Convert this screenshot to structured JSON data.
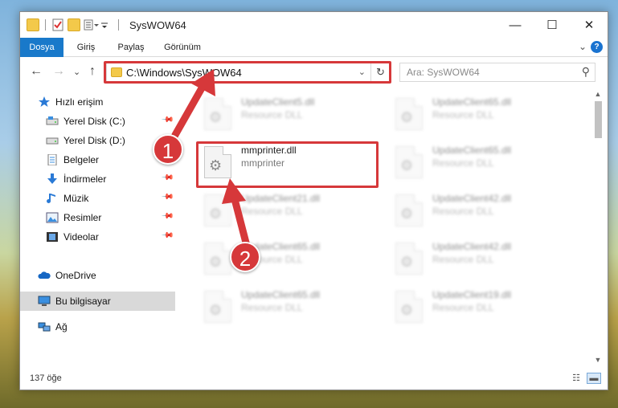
{
  "window": {
    "title": "SysWOW64",
    "controls": {
      "minimize": "—",
      "maximize": "☐",
      "close": "✕"
    }
  },
  "ribbon": {
    "tabs": [
      {
        "label": "Dosya",
        "active": true
      },
      {
        "label": "Giriş",
        "active": false
      },
      {
        "label": "Paylaş",
        "active": false
      },
      {
        "label": "Görünüm",
        "active": false
      }
    ],
    "expand": "⌄",
    "help": "?"
  },
  "nav": {
    "back": "←",
    "forward": "→",
    "recent": "⌄",
    "up": "↑",
    "address": "C:\\Windows\\SysWOW64",
    "address_dropdown": "⌄",
    "refresh": "↻",
    "search_placeholder": "Ara: SysWOW64",
    "search_icon": "⚲"
  },
  "sidebar": {
    "items": [
      {
        "label": "Hızlı erişim",
        "icon": "star-icon",
        "pinned": false
      },
      {
        "label": "Yerel Disk (C:)",
        "icon": "drive-icon",
        "pinned": true
      },
      {
        "label": "Yerel Disk (D:)",
        "icon": "drive-icon",
        "pinned": false
      },
      {
        "label": "Belgeler",
        "icon": "documents-icon",
        "pinned": true
      },
      {
        "label": "İndirmeler",
        "icon": "download-icon",
        "pinned": true
      },
      {
        "label": "Müzik",
        "icon": "music-icon",
        "pinned": true
      },
      {
        "label": "Resimler",
        "icon": "pictures-icon",
        "pinned": true
      },
      {
        "label": "Videolar",
        "icon": "videos-icon",
        "pinned": true
      },
      {
        "label": "OneDrive",
        "icon": "cloud-icon",
        "pinned": false
      },
      {
        "label": "Bu bilgisayar",
        "icon": "computer-icon",
        "pinned": false,
        "selected": true
      },
      {
        "label": "Ağ",
        "icon": "network-icon",
        "pinned": false
      }
    ],
    "pin_glyph": "📌"
  },
  "files": {
    "left": [
      {
        "name": "UpdateClient5.dll",
        "desc": "Resource DLL",
        "blurred": true
      },
      {
        "name": "mmprinter.dll",
        "desc": "mmprinter",
        "blurred": false
      },
      {
        "name": "UpdateClient21.dll",
        "desc": "Resource DLL",
        "blurred": true
      },
      {
        "name": "UpdateClient65.dll",
        "desc": "Resource DLL",
        "blurred": true
      },
      {
        "name": "UpdateClient65.dll",
        "desc": "Resource DLL",
        "blurred": true
      }
    ],
    "right": [
      {
        "name": "UpdateClient65.dll",
        "desc": "Resource DLL",
        "blurred": true
      },
      {
        "name": "UpdateClient65.dll",
        "desc": "Resource DLL",
        "blurred": true
      },
      {
        "name": "UpdateClient42.dll",
        "desc": "Resource DLL",
        "blurred": true
      },
      {
        "name": "UpdateClient42.dll",
        "desc": "Resource DLL",
        "blurred": true
      },
      {
        "name": "UpdateClient19.dll",
        "desc": "Resource DLL",
        "blurred": true
      }
    ]
  },
  "status": {
    "count": "137 öğe"
  },
  "annotations": {
    "step1": "1",
    "step2": "2",
    "accent_color": "#d6383a"
  }
}
